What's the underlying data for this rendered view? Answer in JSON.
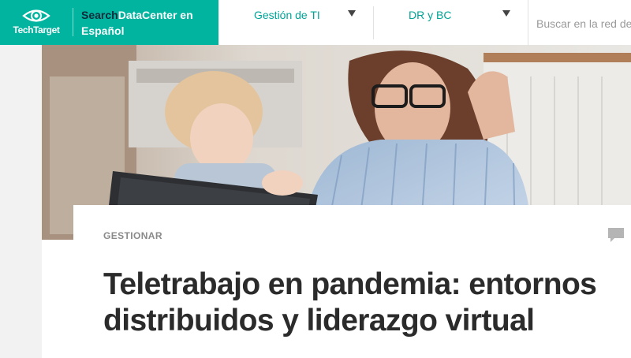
{
  "brand": {
    "logo_text": "TechTarget",
    "title_prefix": "Search",
    "title_rest": "DataCenter en Español"
  },
  "nav": {
    "items": [
      {
        "label": "Gestión de TI"
      },
      {
        "label": "DR y BC"
      }
    ],
    "search_placeholder": "Buscar en la red de"
  },
  "article": {
    "category": "GESTIONAR",
    "headline": "Teletrabajo en pandemia: entornos distribuidos y liderazgo virtual"
  },
  "colors": {
    "brand": "#00b4a0",
    "brand_dark": "#0d2b3a",
    "nav_link": "#00a497",
    "headline": "#2b2b2b"
  },
  "icons": [
    "techtarget-eye-logo",
    "chevron-down-icon",
    "comment-icon"
  ]
}
